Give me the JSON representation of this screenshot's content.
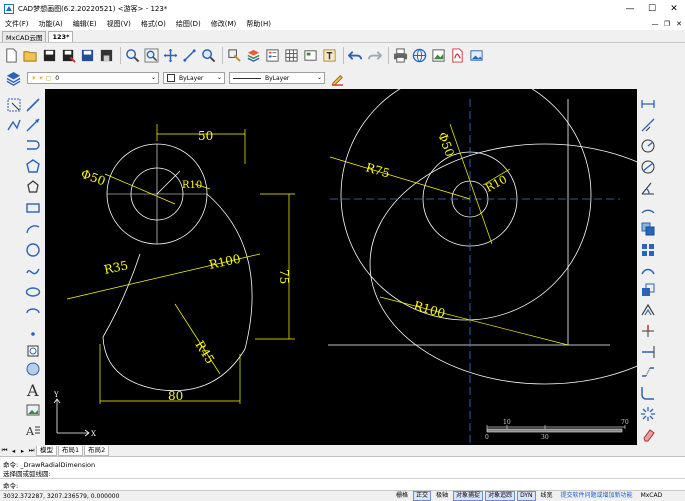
{
  "window": {
    "title": "CAD梦想画图(6.2.20220521) <游客> - 123*",
    "controls": [
      "—",
      "☐",
      "✕"
    ]
  },
  "menu": {
    "items": [
      "文件(F)",
      "功能(A)",
      "编辑(E)",
      "视图(V)",
      "格式(O)",
      "绘图(D)",
      "修改(M)",
      "帮助(H)"
    ],
    "right": [
      "—",
      "❐",
      "✕"
    ]
  },
  "doc_tabs": [
    "MxCAD云图",
    "123*"
  ],
  "layer_bar": {
    "layer_value": "0",
    "color_value": "ByLayer",
    "linetype_value": "ByLayer"
  },
  "drawing": {
    "left_dims": {
      "top_width": "50",
      "phi": "Φ50",
      "r10": "R10",
      "r35": "R35",
      "r100": "R100",
      "height": "75",
      "r45": "R45",
      "bottom_width": "80"
    },
    "right_dims": {
      "phi": "Φ50",
      "r75": "R75",
      "r10": "R10",
      "r100": "R100"
    },
    "scale_bar": [
      "0",
      "10",
      "30",
      "70"
    ],
    "ucs": {
      "x": "X",
      "y": "Y"
    }
  },
  "layout_tabs": [
    "模型",
    "布局1",
    "布局2"
  ],
  "command": {
    "line1": "命令: _DrawRadialDimension",
    "line2": "选择圆或弧线圆:",
    "prompt": "命令:"
  },
  "status": {
    "coords": "3032.372287,  3207.236579,  0.000000",
    "buttons": [
      {
        "label": "栅格",
        "on": false
      },
      {
        "label": "正交",
        "on": true
      },
      {
        "label": "极轴",
        "on": false
      },
      {
        "label": "对象捕捉",
        "on": true
      },
      {
        "label": "对象追踪",
        "on": true
      },
      {
        "label": "DYN",
        "on": true
      },
      {
        "label": "线宽",
        "on": false
      }
    ],
    "feedback": "提交软件问题或增加新功能",
    "brand": "MxCAD"
  },
  "colors": {
    "canvas": "#000000",
    "geometry": "#ffffff",
    "dimension": "#ffff00",
    "axis": "#3a7bd5"
  }
}
